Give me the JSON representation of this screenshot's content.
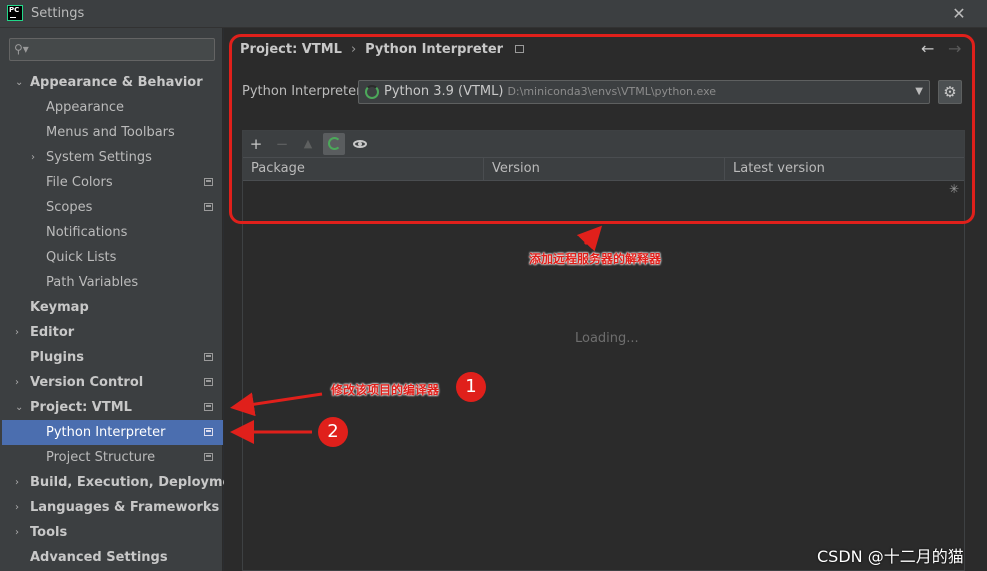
{
  "window": {
    "title": "Settings",
    "logo": "PC"
  },
  "sidebar": {
    "search_placeholder": "",
    "items": [
      {
        "label": "Appearance & Behavior",
        "expanded": true
      },
      {
        "label": "Appearance"
      },
      {
        "label": "Menus and Toolbars"
      },
      {
        "label": "System Settings"
      },
      {
        "label": "File Colors"
      },
      {
        "label": "Scopes"
      },
      {
        "label": "Notifications"
      },
      {
        "label": "Quick Lists"
      },
      {
        "label": "Path Variables"
      },
      {
        "label": "Keymap"
      },
      {
        "label": "Editor"
      },
      {
        "label": "Plugins"
      },
      {
        "label": "Version Control"
      },
      {
        "label": "Project: VTML",
        "expanded": true
      },
      {
        "label": "Python Interpreter",
        "selected": true
      },
      {
        "label": "Project Structure"
      },
      {
        "label": "Build, Execution, Deployment"
      },
      {
        "label": "Languages & Frameworks"
      },
      {
        "label": "Tools"
      },
      {
        "label": "Advanced Settings"
      }
    ]
  },
  "main": {
    "breadcrumb": {
      "project": "Project: VTML",
      "page": "Python Interpreter"
    },
    "interpreter_label": "Python Interpreter:",
    "interpreter_name": "Python 3.9 (VTML)",
    "interpreter_path": "D:\\miniconda3\\envs\\VTML\\python.exe",
    "table": {
      "columns": [
        "Package",
        "Version",
        "Latest version"
      ]
    },
    "loading_text": "Loading..."
  },
  "annotations": {
    "remote_note": "添加远程服务器的解释器",
    "project_note": "修改该项目的编译器",
    "num1": "1",
    "num2": "2",
    "color": "#e0201b"
  },
  "watermark": "CSDN @十二月的猫"
}
